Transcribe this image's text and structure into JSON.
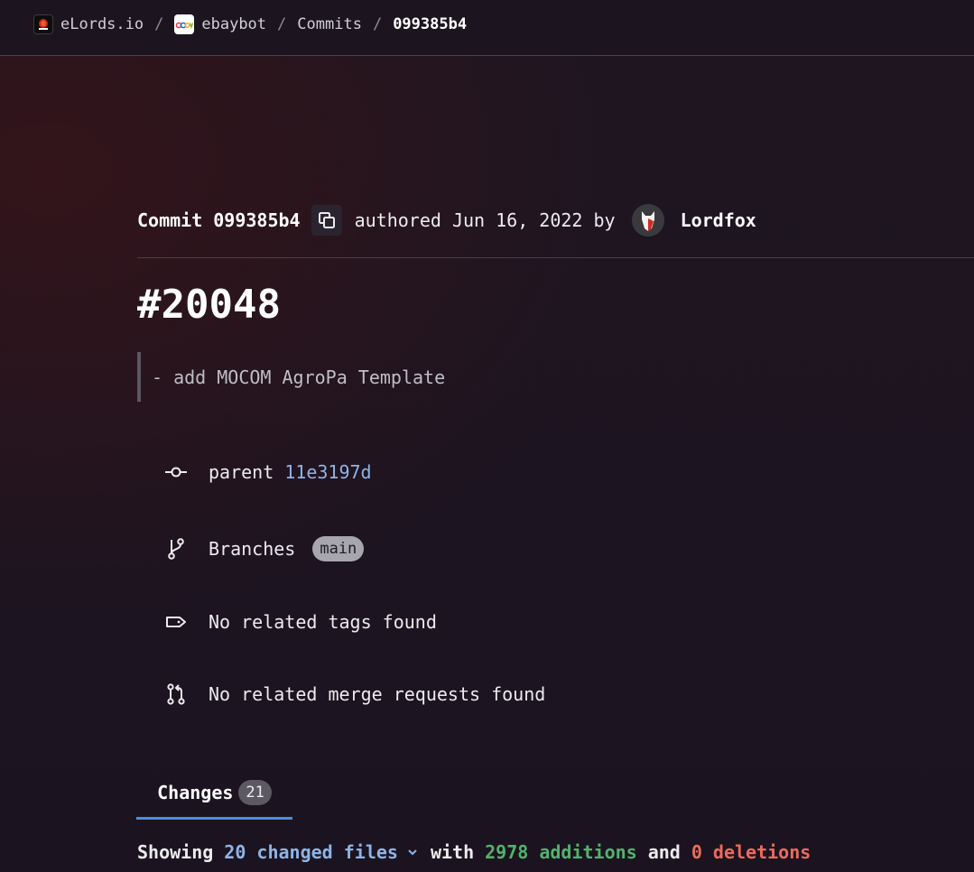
{
  "breadcrumb": {
    "items": [
      {
        "label": "eLords.io",
        "icon": "elords-logo-icon"
      },
      {
        "label": "ebaybot",
        "icon": "ebay-logo-icon"
      },
      {
        "label": "Commits"
      },
      {
        "label": "099385b4"
      }
    ],
    "separator": "/"
  },
  "commit": {
    "label": "Commit",
    "sha": "099385b4",
    "authored_text": "authored Jun 16, 2022 by",
    "author": "Lordfox",
    "title": "#20048",
    "description": "- add MOCOM AgroPa Template"
  },
  "info": {
    "parent_label": "parent",
    "parent_sha": "11e3197d",
    "branches_label": "Branches",
    "branch": "main",
    "tags_text": "No related tags found",
    "mr_text": "No related merge requests found"
  },
  "tabs": [
    {
      "label": "Changes",
      "count": "21"
    }
  ],
  "summary": {
    "showing": "Showing",
    "files": "20 changed files",
    "with": "with",
    "additions": "2978 additions",
    "and": "and",
    "deletions": "0 deletions"
  },
  "colors": {
    "link": "#8eb4e8",
    "additions": "#52b36b",
    "deletions": "#ec6b5a",
    "tab_underline": "#4a8fe0"
  }
}
